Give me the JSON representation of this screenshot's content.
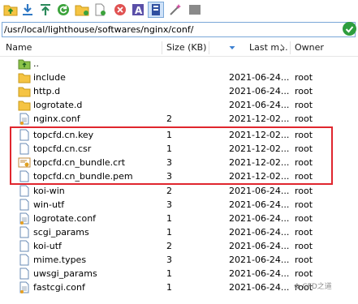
{
  "toolbar": {
    "buttons": [
      {
        "name": "parent-folder-button",
        "icon": "folder-up-icon"
      },
      {
        "name": "download-button",
        "icon": "download-arrow-icon"
      },
      {
        "name": "upload-button",
        "icon": "upload-arrow-icon"
      },
      {
        "name": "refresh-button",
        "icon": "refresh-icon"
      },
      {
        "name": "new-folder-button",
        "icon": "new-folder-icon"
      },
      {
        "name": "new-file-button",
        "icon": "new-file-icon"
      },
      {
        "name": "delete-button",
        "icon": "delete-icon"
      },
      {
        "name": "rename-button",
        "icon": "rename-icon"
      },
      {
        "name": "properties-button",
        "icon": "properties-icon"
      },
      {
        "name": "edit-button",
        "icon": "magic-wand-icon"
      },
      {
        "name": "terminal-button",
        "icon": "terminal-icon"
      }
    ]
  },
  "path": {
    "value": "/usr/local/lighthouse/softwares/nginx/conf/"
  },
  "columns": {
    "name": "Name",
    "size": "Size (KB)",
    "modified": "Last m...",
    "owner": "Owner"
  },
  "files": [
    {
      "name": "..",
      "size": "",
      "modified": "",
      "owner": "",
      "type": "parent"
    },
    {
      "name": "include",
      "size": "",
      "modified": "2021-06-24...",
      "owner": "root",
      "type": "folder"
    },
    {
      "name": "http.d",
      "size": "",
      "modified": "2021-06-24...",
      "owner": "root",
      "type": "folder"
    },
    {
      "name": "logrotate.d",
      "size": "",
      "modified": "2021-06-24...",
      "owner": "root",
      "type": "folder"
    },
    {
      "name": "nginx.conf",
      "size": "2",
      "modified": "2021-12-02...",
      "owner": "root",
      "type": "conf"
    },
    {
      "name": "topcfd.cn.key",
      "size": "1",
      "modified": "2021-12-02...",
      "owner": "root",
      "type": "file"
    },
    {
      "name": "topcfd.cn.csr",
      "size": "1",
      "modified": "2021-12-02...",
      "owner": "root",
      "type": "file"
    },
    {
      "name": "topcfd.cn_bundle.crt",
      "size": "3",
      "modified": "2021-12-02...",
      "owner": "root",
      "type": "cert"
    },
    {
      "name": "topcfd.cn_bundle.pem",
      "size": "3",
      "modified": "2021-12-02...",
      "owner": "root",
      "type": "file"
    },
    {
      "name": "koi-win",
      "size": "2",
      "modified": "2021-06-24...",
      "owner": "root",
      "type": "file"
    },
    {
      "name": "win-utf",
      "size": "3",
      "modified": "2021-06-24...",
      "owner": "root",
      "type": "file"
    },
    {
      "name": "logrotate.conf",
      "size": "1",
      "modified": "2021-06-24...",
      "owner": "root",
      "type": "conf"
    },
    {
      "name": "scgi_params",
      "size": "1",
      "modified": "2021-06-24...",
      "owner": "root",
      "type": "file"
    },
    {
      "name": "koi-utf",
      "size": "2",
      "modified": "2021-06-24...",
      "owner": "root",
      "type": "file"
    },
    {
      "name": "mime.types",
      "size": "3",
      "modified": "2021-06-24...",
      "owner": "root",
      "type": "file"
    },
    {
      "name": "uwsgi_params",
      "size": "1",
      "modified": "2021-06-24...",
      "owner": "root",
      "type": "file"
    },
    {
      "name": "fastcgi.conf",
      "size": "1",
      "modified": "2021-06-24...",
      "owner": "root",
      "type": "conf"
    }
  ],
  "watermark": "CFD之道",
  "colors": {
    "accent": "#7aa7d8",
    "highlight": "#e0262e",
    "folder": "#f5c443",
    "ok": "#2e9e3e"
  }
}
